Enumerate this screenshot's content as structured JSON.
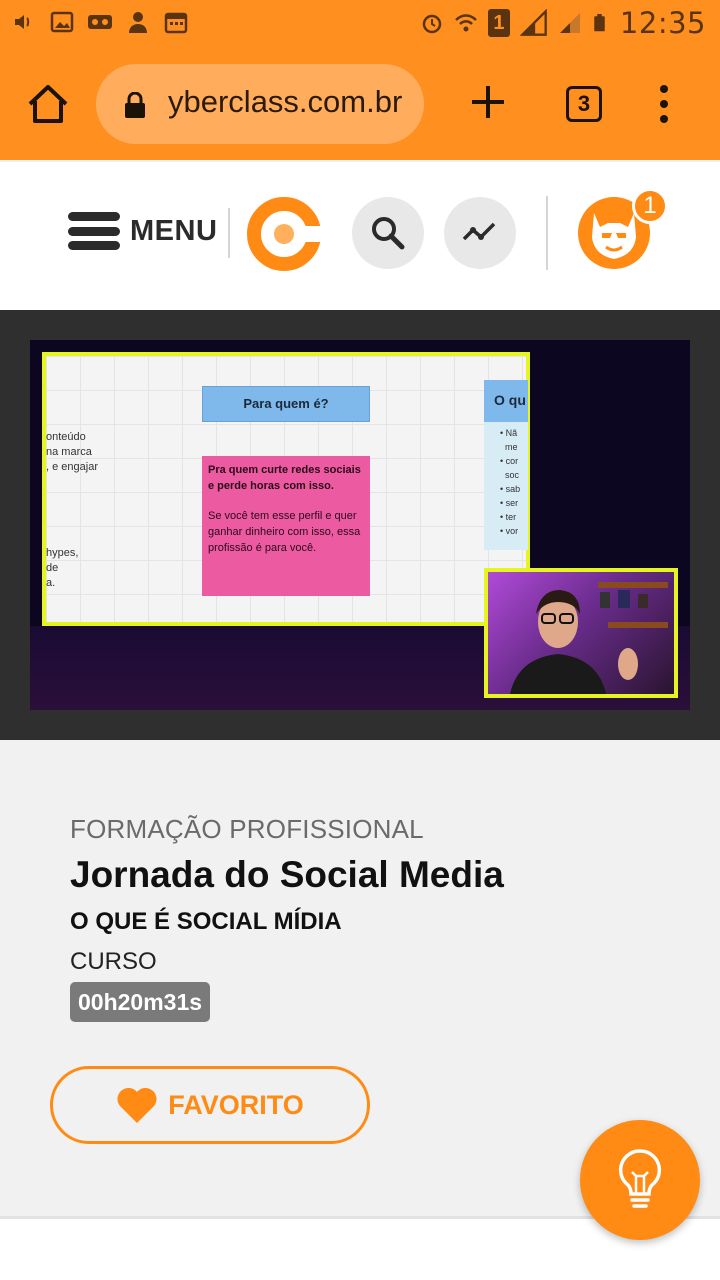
{
  "status_bar": {
    "time": "12:35",
    "sim_slot": "1",
    "left_icons": [
      "volume-icon",
      "image-icon",
      "voicemail-icon",
      "person-icon",
      "calendar-icon"
    ],
    "right_icons": [
      "alarm-icon",
      "wifi-icon",
      "sim-icon",
      "signal-icon",
      "signal-icon",
      "battery-icon"
    ]
  },
  "browser": {
    "url": "yberclass.com.br",
    "tab_count": "3"
  },
  "header": {
    "menu_label": "MENU",
    "notification_count": "1"
  },
  "video": {
    "slide": {
      "left_text_1": "onteúdo\nna marca\n, e engajar",
      "left_text_2": "hypes,\nde\na.",
      "box_title": "Para quem é?",
      "card_bold": "Pra quem curte redes sociais e perde horas com isso.",
      "card_text": "Se você tem esse perfil e quer ganhar dinheiro com isso, essa profissão é para você.",
      "right_title": "O qu",
      "right_list": [
        "Nã",
        "me",
        "cor",
        "soc",
        "sab",
        "ser",
        "ter",
        "vor"
      ]
    }
  },
  "course": {
    "category": "FORMAÇÃO PROFISSIONAL",
    "title": "Jornada do Social Media",
    "lesson": "O QUE É SOCIAL MÍDIA",
    "type": "CURSO",
    "duration": "00h20m31s",
    "favorite_label": "FAVORITO"
  },
  "colors": {
    "brand_orange": "#ff8a14",
    "status_bar": "#ff8f1f",
    "slide_border": "#e6f51f",
    "card_pink": "#ec5aa2",
    "box_blue": "#7fb8ea"
  }
}
